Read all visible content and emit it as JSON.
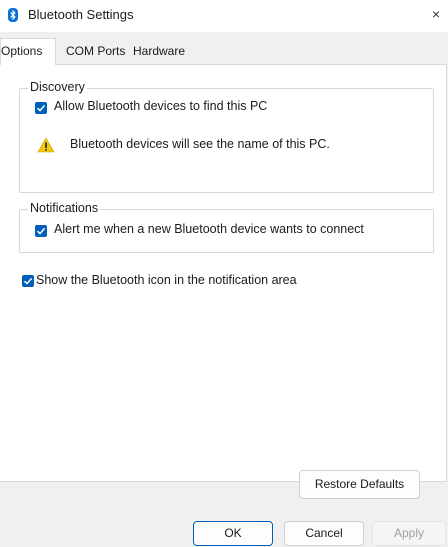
{
  "window": {
    "title": "Bluetooth Settings",
    "close_glyph": "×",
    "icon": "bluetooth-icon"
  },
  "tabs": [
    {
      "label": "Options",
      "active": true
    },
    {
      "label": "COM Ports",
      "active": false
    },
    {
      "label": "Hardware",
      "active": false
    }
  ],
  "discovery": {
    "title": "Discovery",
    "allow_label": "Allow Bluetooth devices to find this PC",
    "allow_checked": true,
    "warning_text": "Bluetooth devices will see the name of this PC.",
    "warning_icon": "warning-icon"
  },
  "notifications": {
    "title": "Notifications",
    "alert_label": "Alert me when a new Bluetooth device wants to connect",
    "alert_checked": true
  },
  "show_icon": {
    "label": "Show the Bluetooth icon in the notification area",
    "checked": true
  },
  "buttons": {
    "restore": "Restore Defaults",
    "ok": "OK",
    "cancel": "Cancel",
    "apply": "Apply"
  },
  "colors": {
    "accent": "#005fb8",
    "warning": "#f2c811"
  }
}
